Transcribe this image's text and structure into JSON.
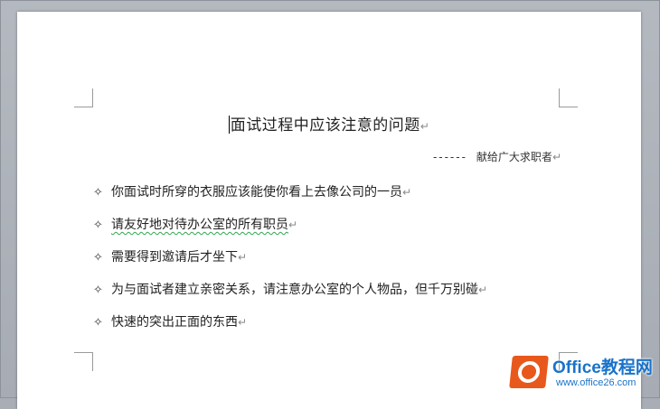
{
  "document": {
    "title": "面试过程中应该注意的问题",
    "paragraph_mark": "↵",
    "subtitle_dashes": "------",
    "subtitle": "献给广大求职者",
    "bullet_glyph": "✧",
    "bullets": [
      "你面试时所穿的衣服应该能使你看上去像公司的一员",
      "请友好地对待办公室的所有职员",
      "需要得到邀请后才坐下",
      "为与面试者建立亲密关系，请注意办公室的个人物品，但千万别碰",
      "快速的突出正面的东西"
    ]
  },
  "watermark": {
    "brand": "Office教程网",
    "url": "www.office26.com"
  },
  "colors": {
    "logo_orange": "#e8581c",
    "logo_blue": "#1a73c9",
    "spellcheck_green": "#2fa84f"
  }
}
